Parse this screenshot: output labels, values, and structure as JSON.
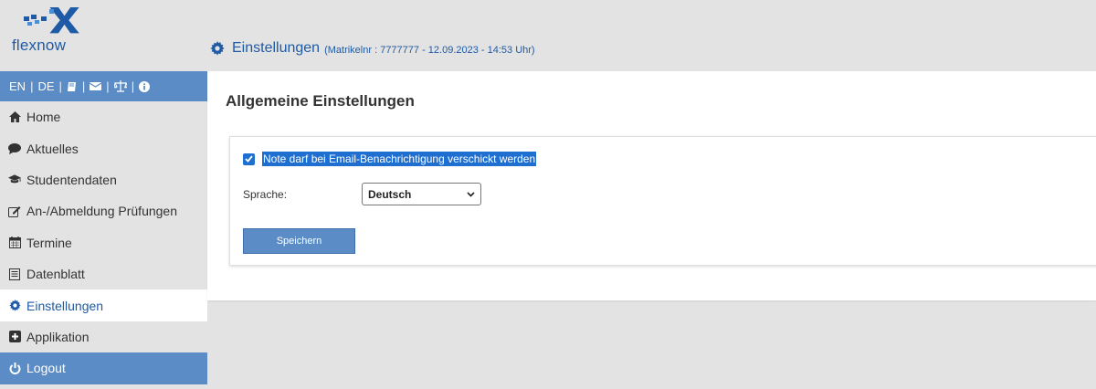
{
  "app": {
    "logo_text": "flexnow",
    "brand_color": "#1f5aa6",
    "accent_color": "#5b8cc6"
  },
  "header": {
    "title": "Einstellungen",
    "meta": "(Matrikelnr : 7777777 - 12.09.2023 - 14:53 Uhr)",
    "icon": "gear-icon"
  },
  "langbar": {
    "en": "EN",
    "de": "DE",
    "separator": "|",
    "icons": [
      "book-icon",
      "mail-icon",
      "scale-icon",
      "info-icon"
    ]
  },
  "sidebar": {
    "items": [
      {
        "label": "Home",
        "icon": "home-icon"
      },
      {
        "label": "Aktuelles",
        "icon": "comment-icon"
      },
      {
        "label": "Studentendaten",
        "icon": "graduation-cap-icon"
      },
      {
        "label": "An-/Abmeldung Prüfungen",
        "icon": "edit-icon"
      },
      {
        "label": "Termine",
        "icon": "calendar-icon"
      },
      {
        "label": "Datenblatt",
        "icon": "datasheet-icon"
      },
      {
        "label": "Einstellungen",
        "icon": "gear-icon",
        "active": true
      },
      {
        "label": "Applikation",
        "icon": "plus-square-icon"
      }
    ],
    "logout": {
      "label": "Logout",
      "icon": "power-icon"
    }
  },
  "main": {
    "heading": "Allgemeine Einstellungen",
    "checkbox": {
      "label": "Note darf bei Email-Benachrichtigung verschickt werden",
      "checked": true
    },
    "language": {
      "label": "Sprache:",
      "selected": "Deutsch"
    },
    "save_label": "Speichern"
  }
}
